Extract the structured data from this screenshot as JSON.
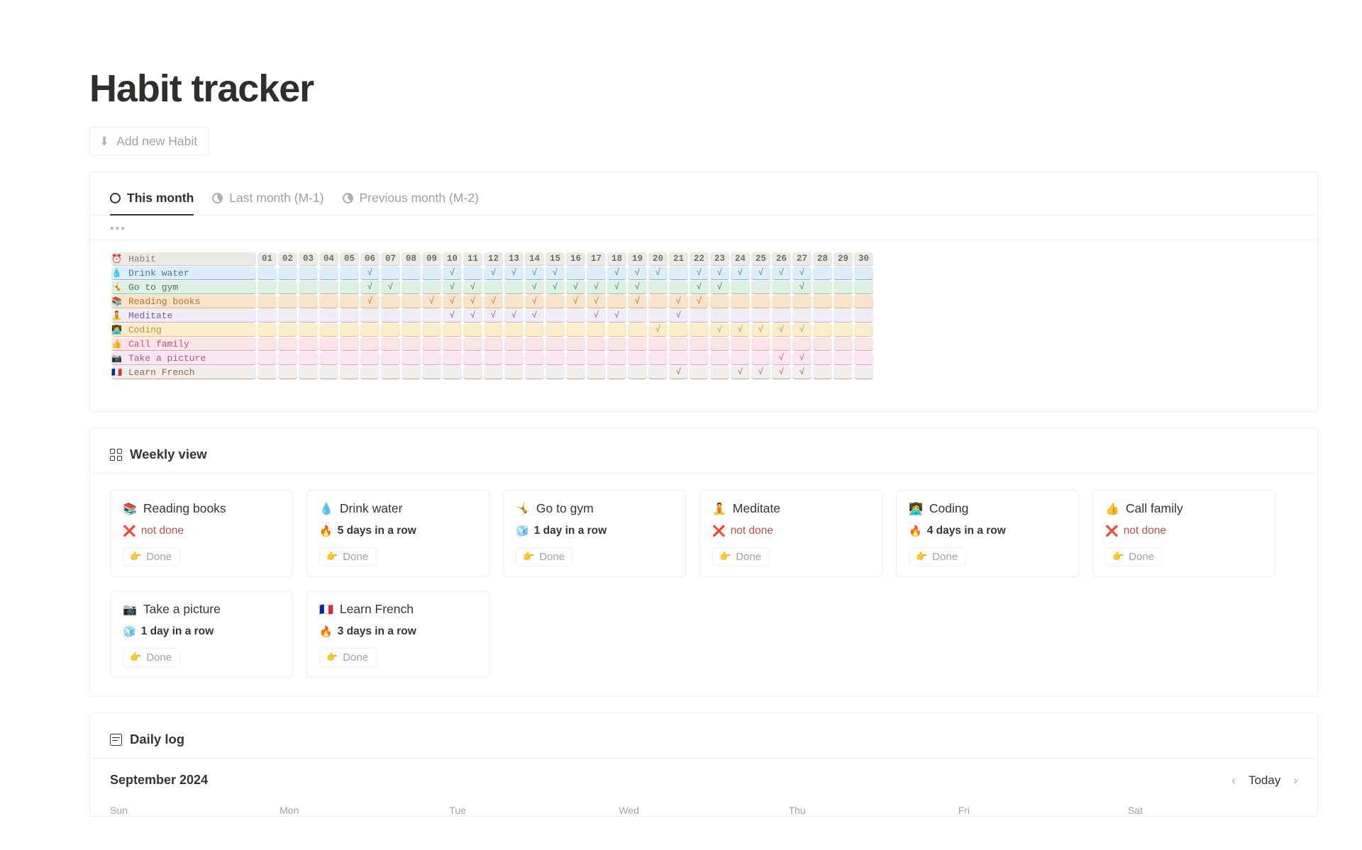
{
  "header": {
    "title": "Habit tracker",
    "add_habit_label": "Add new Habit",
    "add_habit_icon": "download-arrow-icon"
  },
  "tabs": [
    {
      "label": "This month",
      "icon": "circle-empty-icon",
      "active": true
    },
    {
      "label": "Last month (M-1)",
      "icon": "pie-partial-icon",
      "active": false
    },
    {
      "label": "Previous month (M-2)",
      "icon": "pie-partial-icon",
      "active": false
    }
  ],
  "matrix": {
    "toolbar_dots": "•••",
    "header_label": "Habit",
    "header_emoji": "⏰",
    "days": [
      "01",
      "02",
      "03",
      "04",
      "05",
      "06",
      "07",
      "08",
      "09",
      "10",
      "11",
      "12",
      "13",
      "14",
      "15",
      "16",
      "17",
      "18",
      "19",
      "20",
      "21",
      "22",
      "23",
      "24",
      "25",
      "26",
      "27",
      "28",
      "29",
      "30"
    ],
    "check_glyph": "√",
    "rows": [
      {
        "emoji": "💧",
        "label": "Drink water",
        "bg": "#ddeefa",
        "fg": "#3d7ba8",
        "border": "#7fb2d0",
        "checks": [
          6,
          10,
          12,
          13,
          14,
          15,
          18,
          19,
          20,
          22,
          23,
          24,
          25,
          26,
          27
        ]
      },
      {
        "emoji": "🤸",
        "label": "Go to gym",
        "bg": "#e2efe6",
        "fg": "#3f7a52",
        "border": "#8cbf9c",
        "checks": [
          6,
          7,
          10,
          11,
          14,
          15,
          16,
          17,
          18,
          19,
          22,
          23,
          27
        ]
      },
      {
        "emoji": "📚",
        "label": "Reading books",
        "bg": "#fbe3cb",
        "fg": "#b96e28",
        "border": "#ddab75",
        "checks": [
          6,
          9,
          10,
          11,
          12,
          14,
          16,
          17,
          19,
          21,
          22
        ]
      },
      {
        "emoji": "🧘",
        "label": "Meditate",
        "bg": "#f2ecf7",
        "fg": "#7a5ba3",
        "border": "#bca6d4",
        "checks": [
          10,
          11,
          12,
          13,
          14,
          17,
          18,
          21
        ]
      },
      {
        "emoji": "👩‍💻",
        "label": "Coding",
        "bg": "#fbeccb",
        "fg": "#b99338",
        "border": "#ddc275",
        "checks": [
          20,
          23,
          24,
          25,
          26,
          27
        ]
      },
      {
        "emoji": "👍",
        "label": "Call family",
        "bg": "#fbe4e8",
        "fg": "#b9567a",
        "border": "#dd9cb0",
        "checks": []
      },
      {
        "emoji": "📷",
        "label": "Take a picture",
        "bg": "#f9e6f2",
        "fg": "#a8589a",
        "border": "#d29ec8",
        "checks": [
          26,
          27
        ]
      },
      {
        "emoji": "🇫🇷",
        "label": "Learn French",
        "bg": "#f2eeec",
        "fg": "#9a5f52",
        "border": "#c8a59a",
        "checks": [
          21,
          24,
          25,
          26,
          27
        ]
      }
    ]
  },
  "weekly": {
    "section_title": "Weekly view",
    "section_icon": "grid-icon",
    "done_label": "Done",
    "done_emoji": "👉",
    "cards": [
      {
        "emoji": "📚",
        "name": "Reading books",
        "status": "not done",
        "status_emoji": "❌",
        "state": "notdone"
      },
      {
        "emoji": "💧",
        "name": "Drink water",
        "status": "5 days in a row",
        "status_emoji": "🔥",
        "state": "streak"
      },
      {
        "emoji": "🤸",
        "name": "Go to gym",
        "status": "1 day in a row",
        "status_emoji": "🧊",
        "state": "streak"
      },
      {
        "emoji": "🧘",
        "name": "Meditate",
        "status": "not done",
        "status_emoji": "❌",
        "state": "notdone"
      },
      {
        "emoji": "👩‍💻",
        "name": "Coding",
        "status": "4 days in a row",
        "status_emoji": "🔥",
        "state": "streak"
      },
      {
        "emoji": "👍",
        "name": "Call family",
        "status": "not done",
        "status_emoji": "❌",
        "state": "notdone"
      },
      {
        "emoji": "📷",
        "name": "Take a picture",
        "status": "1 day in a row",
        "status_emoji": "🧊",
        "state": "streak"
      },
      {
        "emoji": "🇫🇷",
        "name": "Learn French",
        "status": "3 days in a row",
        "status_emoji": "🔥",
        "state": "streak"
      }
    ]
  },
  "daily_log": {
    "section_title": "Daily log",
    "section_icon": "log-icon",
    "month_label": "September 2024",
    "today_label": "Today",
    "prev_icon": "chevron-left-icon",
    "next_icon": "chevron-right-icon",
    "weekdays": [
      "Sun",
      "Mon",
      "Tue",
      "Wed",
      "Thu",
      "Fri",
      "Sat"
    ]
  },
  "colors": {
    "text": "#37352f",
    "muted": "#a5a29c",
    "border": "#ededec",
    "danger": "#c0504d"
  }
}
